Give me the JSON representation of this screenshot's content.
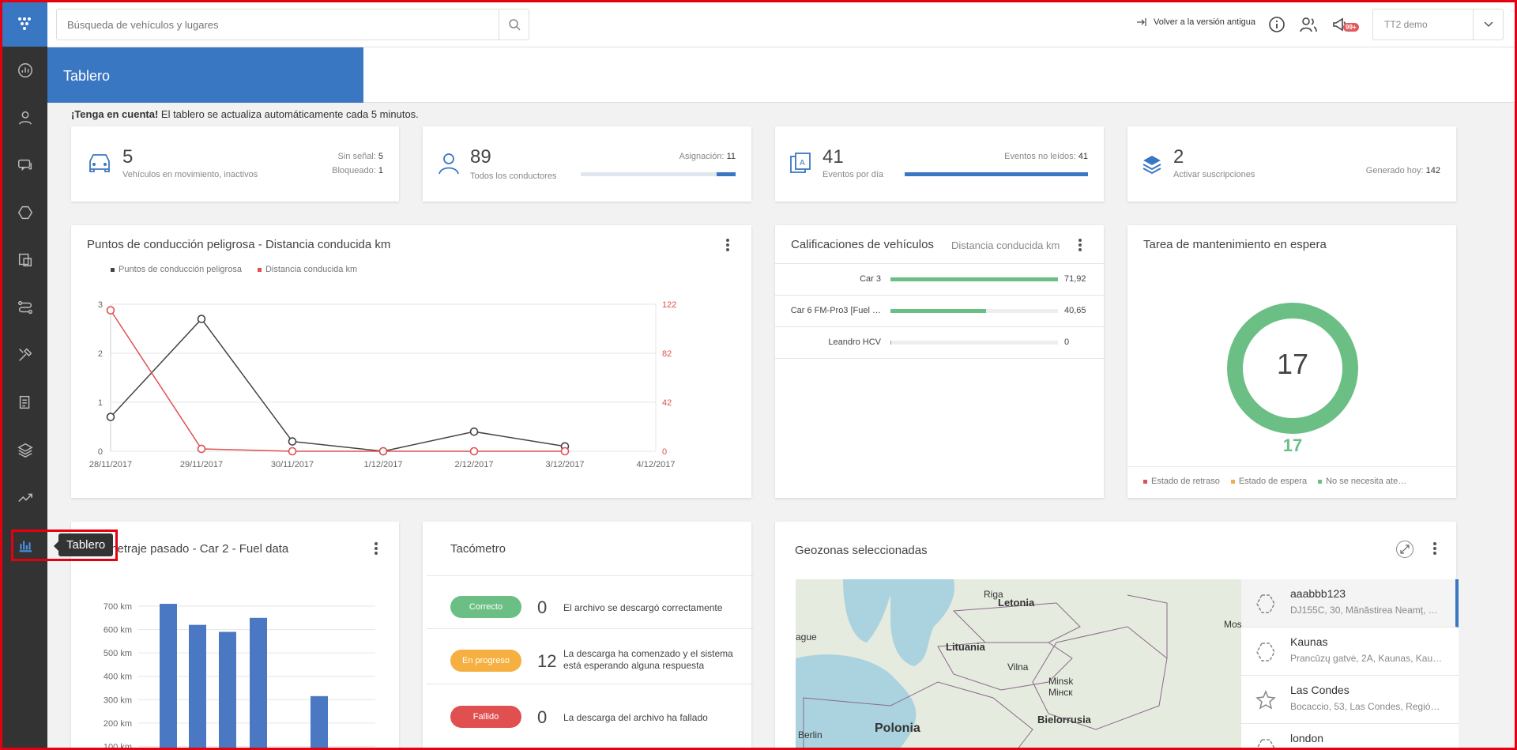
{
  "header": {
    "search_placeholder": "Búsqueda de vehículos y lugares",
    "old_version_link": "Volver a la versión antigua",
    "notifications_badge": "99+",
    "account_name": "TT2 demo"
  },
  "sidebar": {
    "tooltip": "Tablero",
    "items": [
      "dashboard-gauge-icon",
      "driver-icon",
      "messages-icon",
      "geozones-icon",
      "tasks-icon",
      "routes-icon",
      "maintenance-icon",
      "documents-icon",
      "layers-icon",
      "trend-icon",
      "bar-chart-icon"
    ]
  },
  "page": {
    "title": "Tablero",
    "notice_bold": "¡Tenga en cuenta!",
    "notice_text": " El tablero se actualiza automáticamente cada 5 minutos."
  },
  "stats": {
    "vehicles": {
      "number": "5",
      "label": "Vehículos en movimiento, inactivos",
      "no_signal_label": "Sin señal:",
      "no_signal": "5",
      "blocked_label": "Bloqueado:",
      "blocked": "1"
    },
    "drivers": {
      "number": "89",
      "label": "Todos los conductores",
      "assign_label": "Asignación:",
      "assign": "11",
      "fill": 0.12
    },
    "events": {
      "number": "41",
      "label": "Eventos por día",
      "unread_label": "Eventos no leídos:",
      "unread": "41",
      "fill": 1.0
    },
    "subs": {
      "number": "2",
      "label": "Activar suscripciones",
      "generated_label": "Generado hoy:",
      "generated": "142"
    }
  },
  "danger_chart": {
    "title": "Puntos de conducción peligrosa - Distancia conducida km",
    "colors": {
      "danger": "#444444",
      "distance": "#e05050"
    }
  },
  "chart_data": [
    {
      "type": "line",
      "title": "Puntos de conducción peligrosa - Distancia conducida km",
      "x": [
        "28/11/2017",
        "29/11/2017",
        "30/11/2017",
        "1/12/2017",
        "2/12/2017",
        "3/12/2017",
        "4/12/2017"
      ],
      "series": [
        {
          "name": "Puntos de conducción peligrosa",
          "axis": "left",
          "values": [
            0.7,
            2.7,
            0.2,
            0,
            0.4,
            0.1,
            null
          ]
        },
        {
          "name": "Distancia conducida km",
          "axis": "right",
          "values": [
            117,
            2,
            0,
            0,
            0,
            0,
            null
          ]
        }
      ],
      "y_left_ticks": [
        "0",
        "1",
        "2",
        "3"
      ],
      "y_left_range": [
        0,
        3
      ],
      "y_right_ticks": [
        "0",
        "42",
        "82",
        "122"
      ],
      "y_right_range": [
        0,
        122
      ]
    },
    {
      "type": "bar",
      "title": "…metraje pasado - Car 2 - Fuel data",
      "y_ticks": [
        "100 km",
        "200 km",
        "300 km",
        "400 km",
        "500 km",
        "600 km",
        "700 km"
      ],
      "values": [
        710,
        620,
        590,
        650,
        null,
        315
      ],
      "ylim": [
        0,
        700
      ]
    },
    {
      "type": "pie",
      "title": "Tarea de mantenimiento en espera",
      "center_value": "17",
      "total_label": "17",
      "legend": [
        "Estado de retraso",
        "Estado de espera",
        "No se necesita ate…"
      ],
      "legend_colors": [
        "#e05050",
        "#f0ad4e",
        "#6cbf84"
      ],
      "values": [
        0,
        0,
        17
      ]
    }
  ],
  "ratings": {
    "title": "Calificaciones de vehículos",
    "subtitle": "Distancia conducida km",
    "rows": [
      {
        "name": "Car 3",
        "value": "71,92",
        "fill": 1.0
      },
      {
        "name": "Car 6 FM-Pro3 [Fuel …",
        "value": "40,65",
        "fill": 0.57
      },
      {
        "name": "Leandro HCV",
        "value": "0",
        "fill": 0.005
      }
    ]
  },
  "maintenance": {
    "title": "Tarea de mantenimiento en espera",
    "center": "17",
    "below": "17",
    "legend": [
      "Estado de retraso",
      "Estado de espera",
      "No se necesita ate…"
    ]
  },
  "fuel": {
    "title_visible": "metraje pasado - Car 2 - Fuel data"
  },
  "tachometer": {
    "title": "Tacómetro",
    "rows": [
      {
        "status": "Correcto",
        "color": "#6cbf84",
        "count": "0",
        "desc": "El archivo se descargó correctamente"
      },
      {
        "status": "En progreso",
        "color": "#f5b041",
        "count": "12",
        "desc": "La descarga ha comenzado y el sistema está esperando alguna respuesta"
      },
      {
        "status": "Fallido",
        "color": "#e05050",
        "count": "0",
        "desc": "La descarga del archivo ha fallado"
      }
    ]
  },
  "geozones": {
    "title": "Geozonas seleccionadas",
    "items": [
      {
        "name": "aaabbb123",
        "addr": "DJ155C, 30, Mănăstirea Neamț, …",
        "icon": "polygon-icon"
      },
      {
        "name": "Kaunas",
        "addr": "Prancūzų gatvė, 2A, Kaunas, Kau…",
        "icon": "polygon-icon"
      },
      {
        "name": "Las Condes",
        "addr": "Bocaccio, 53, Las Condes, Regió…",
        "icon": "star-icon"
      },
      {
        "name": "london",
        "addr": "",
        "icon": "polygon-icon"
      }
    ],
    "map_labels": {
      "riga": "Riga",
      "letonia": "Letonia",
      "lituania": "Lituania",
      "vilna": "Vilna",
      "minsk": "Minsk",
      "minsk_cyr": "Мінск",
      "bielorrusia": "Bielorrusia",
      "polonia": "Polonia",
      "berlin": "Berlin",
      "praga": "ague",
      "moscow": "Mos"
    }
  }
}
